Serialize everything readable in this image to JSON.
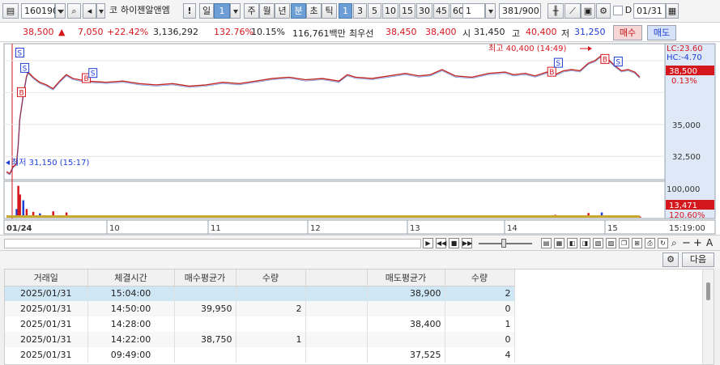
{
  "toolbar": {
    "code": "160190",
    "market_tag": "코",
    "stock_name": "하이젠알앤엠",
    "exclaim": "!",
    "period_day": "일",
    "period_num": "1",
    "period_week": "주",
    "period_month": "월",
    "period_year": "년",
    "period_minute": "분",
    "period_second": "초",
    "period_tick": "틱",
    "minute_options": [
      "1",
      "3",
      "5",
      "10",
      "15",
      "30",
      "45",
      "60"
    ],
    "selected_minute": "1",
    "count_value": "1",
    "bar_count": "381",
    "bar_max": "/900",
    "date_check_label": "D",
    "date_value": "01/31"
  },
  "infobar": {
    "price": "38,500",
    "change_arrow": "▲",
    "change": "7,050",
    "change_rate": "+22.42%",
    "volume": "3,136,292",
    "volume_ratio": "132.76%",
    "turnover_rate": "10.15%",
    "amount": "116,761백만",
    "priority_label": "최우선",
    "ask_price": "38,450",
    "bid_price": "38,400",
    "open_label": "시",
    "open": "31,450",
    "high_label": "고",
    "high": "40,400",
    "low_label": "저",
    "low": "31,250",
    "buy_button": "매수",
    "sell_button": "매도"
  },
  "chart_labels": {
    "lc": "LC:23.60",
    "hc": "HC:-4.70",
    "current_price": "38,500",
    "current_rate": "0.13%",
    "high_annotation": "최고 40,400 (14:49)",
    "low_annotation": "최저 31,150 (15:17)",
    "volume_max": "100,000",
    "volume_current": "13,471",
    "volume_rate": "120.60%",
    "buy_marker": "B",
    "sell_marker": "S",
    "current_time": "15:19:00"
  },
  "chart_data": {
    "type": "line",
    "price_axis": {
      "ticks": [
        32500,
        35000,
        37500,
        40000
      ],
      "tick_labels": [
        "32,500",
        "35,000",
        "",
        ""
      ],
      "range": [
        30800,
        41200
      ]
    },
    "volume_axis": {
      "ticks": [
        100000
      ],
      "tick_labels": [
        "100,000"
      ]
    },
    "x_tick_labels": [
      "01/24",
      "10",
      "11",
      "12",
      "13",
      "14",
      "15",
      "15:19:00"
    ],
    "price_points": [
      [
        0,
        31300
      ],
      [
        2,
        31150
      ],
      [
        4,
        31700
      ],
      [
        6,
        31900
      ],
      [
        7,
        33300
      ],
      [
        8,
        35400
      ],
      [
        10,
        37200
      ],
      [
        12,
        38700
      ],
      [
        13,
        39100
      ],
      [
        16,
        38700
      ],
      [
        20,
        38300
      ],
      [
        24,
        38100
      ],
      [
        28,
        37800
      ],
      [
        32,
        38400
      ],
      [
        36,
        38900
      ],
      [
        40,
        38600
      ],
      [
        48,
        38400
      ],
      [
        60,
        38300
      ],
      [
        70,
        38400
      ],
      [
        80,
        38200
      ],
      [
        90,
        38100
      ],
      [
        100,
        38200
      ],
      [
        110,
        38000
      ],
      [
        120,
        38100
      ],
      [
        130,
        38300
      ],
      [
        140,
        38200
      ],
      [
        150,
        38400
      ],
      [
        160,
        38600
      ],
      [
        170,
        38700
      ],
      [
        180,
        38500
      ],
      [
        190,
        38600
      ],
      [
        200,
        38400
      ],
      [
        205,
        38900
      ],
      [
        210,
        38700
      ],
      [
        220,
        38600
      ],
      [
        230,
        38800
      ],
      [
        240,
        39000
      ],
      [
        248,
        38800
      ],
      [
        255,
        38900
      ],
      [
        262,
        39300
      ],
      [
        270,
        38800
      ],
      [
        280,
        38700
      ],
      [
        290,
        39000
      ],
      [
        300,
        39100
      ],
      [
        305,
        38900
      ],
      [
        312,
        39000
      ],
      [
        318,
        38800
      ],
      [
        325,
        39100
      ],
      [
        330,
        38900
      ],
      [
        335,
        39200
      ],
      [
        340,
        39300
      ],
      [
        345,
        39200
      ],
      [
        350,
        39800
      ],
      [
        354,
        40000
      ],
      [
        358,
        40400
      ],
      [
        362,
        40100
      ],
      [
        366,
        39600
      ],
      [
        370,
        39200
      ],
      [
        374,
        39300
      ],
      [
        378,
        39100
      ],
      [
        381,
        38700
      ]
    ],
    "volume_points": [
      [
        2,
        8000
      ],
      [
        4,
        4000
      ],
      [
        6,
        30000
      ],
      [
        7,
        110000
      ],
      [
        8,
        80000
      ],
      [
        10,
        60000
      ],
      [
        12,
        30000
      ],
      [
        16,
        20000
      ],
      [
        20,
        15000
      ],
      [
        28,
        22000
      ],
      [
        36,
        18000
      ],
      [
        44,
        8000
      ],
      [
        60,
        5000
      ],
      [
        100,
        4000
      ],
      [
        150,
        6000
      ],
      [
        200,
        8000
      ],
      [
        250,
        5000
      ],
      [
        300,
        4000
      ],
      [
        330,
        10000
      ],
      [
        350,
        16000
      ],
      [
        358,
        18000
      ],
      [
        370,
        8000
      ],
      [
        381,
        4000
      ]
    ],
    "buy_markers": [
      [
        9,
        37500
      ],
      [
        48,
        38600
      ],
      [
        328,
        39100
      ],
      [
        360,
        40100
      ]
    ],
    "sell_markers": [
      [
        8,
        40600
      ],
      [
        11,
        39400
      ],
      [
        52,
        39000
      ],
      [
        332,
        39800
      ],
      [
        368,
        39900
      ]
    ]
  },
  "table": {
    "next_button": "다음",
    "headers": [
      "거래일",
      "체결시간",
      "매수평균가",
      "수량",
      "",
      "매도평균가",
      "수량"
    ],
    "rows": [
      [
        "2025/01/31",
        "15:04:00",
        "",
        "",
        "",
        "38,900",
        "2"
      ],
      [
        "2025/01/31",
        "14:50:00",
        "39,950",
        "2",
        "",
        "",
        "0"
      ],
      [
        "2025/01/31",
        "14:28:00",
        "",
        "",
        "",
        "38,400",
        "1"
      ],
      [
        "2025/01/31",
        "14:22:00",
        "38,750",
        "1",
        "",
        "",
        "0"
      ],
      [
        "2025/01/31",
        "09:49:00",
        "",
        "",
        "",
        "37,525",
        "4"
      ]
    ]
  },
  "colors": {
    "up": "#d4161d",
    "down": "#1d3fd6",
    "highlight_row": "#cfe6f5",
    "selected_button": "#6d9fd6"
  }
}
